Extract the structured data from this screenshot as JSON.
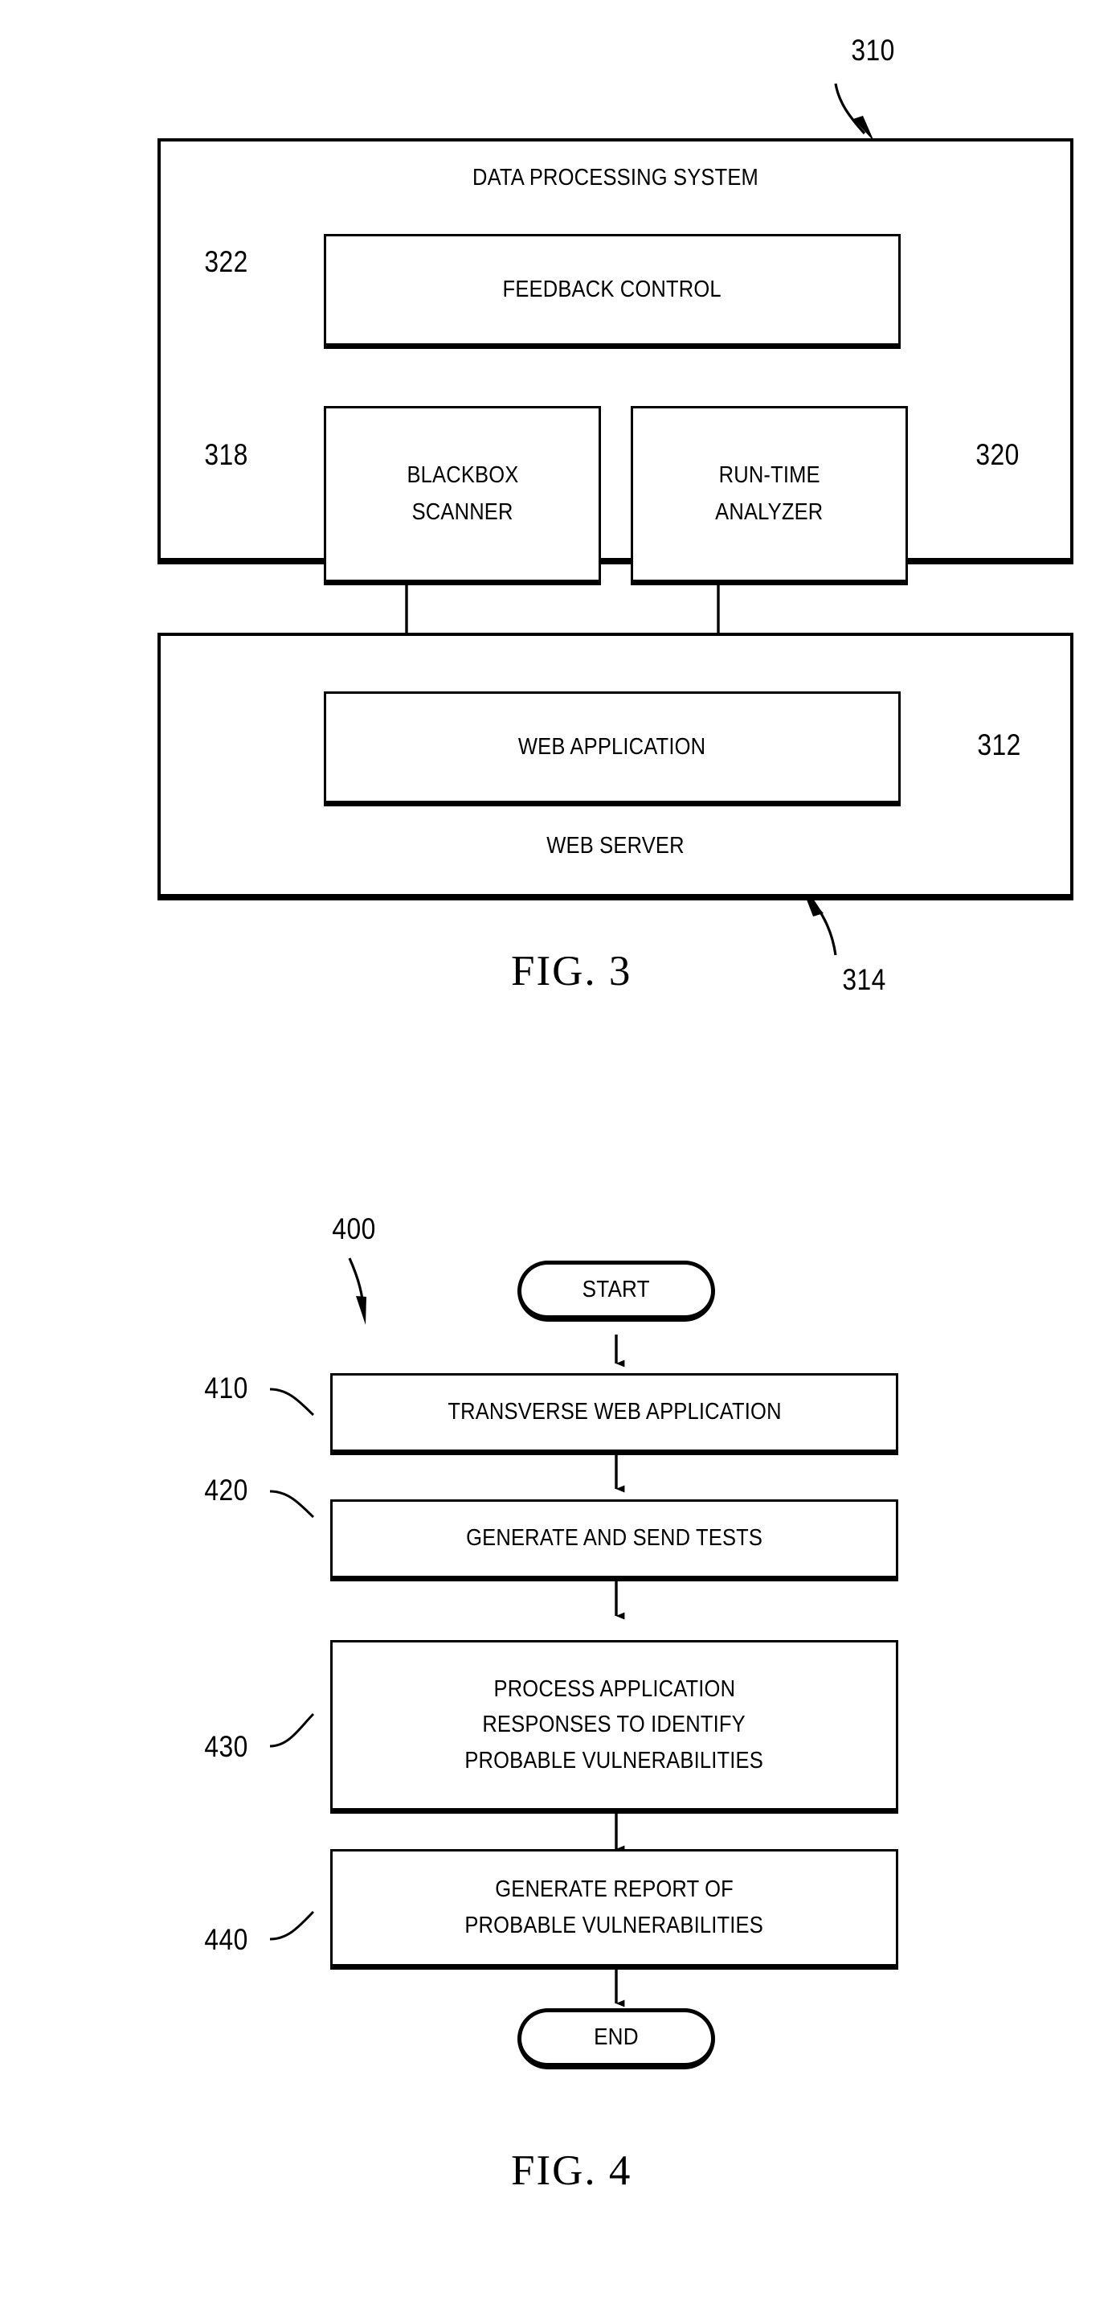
{
  "document": {
    "type": "patent-drawing-sheet",
    "figures": [
      "FIG. 3",
      "FIG. 4"
    ]
  },
  "fig3": {
    "caption": "FIG. 3",
    "system_ref": "310",
    "server_ref": "314",
    "outer_box": {
      "label": "DATA PROCESSING SYSTEM",
      "ref": "310"
    },
    "blocks": [
      {
        "label": "FEEDBACK CONTROL",
        "ref": "322",
        "ref_side": "left"
      },
      {
        "label": "BLACKBOX\nSCANNER",
        "line1": "BLACKBOX",
        "line2": "SCANNER",
        "ref": "318",
        "ref_side": "left"
      },
      {
        "label": "RUN-TIME\nANALYZER",
        "line1": "RUN-TIME",
        "line2": "ANALYZER",
        "ref": "320",
        "ref_side": "right"
      }
    ],
    "server_box": {
      "label": "WEB SERVER",
      "ref": "314",
      "inner_block": {
        "label": "WEB APPLICATION",
        "ref": "312",
        "ref_side": "right"
      }
    }
  },
  "fig4": {
    "caption": "FIG. 4",
    "flow_ref": "400",
    "start_label": "START",
    "end_label": "END",
    "steps": [
      {
        "ref": "410",
        "lines": [
          "TRANSVERSE WEB APPLICATION"
        ]
      },
      {
        "ref": "420",
        "lines": [
          "GENERATE AND SEND TESTS"
        ]
      },
      {
        "ref": "430",
        "lines": [
          "PROCESS APPLICATION",
          "RESPONSES TO IDENTIFY",
          "PROBABLE VULNERABILITIES"
        ]
      },
      {
        "ref": "440",
        "lines": [
          "GENERATE REPORT OF",
          "PROBABLE VULNERABILITIES"
        ]
      }
    ]
  },
  "colors": {
    "ink": "#000000",
    "paper": "#ffffff"
  }
}
